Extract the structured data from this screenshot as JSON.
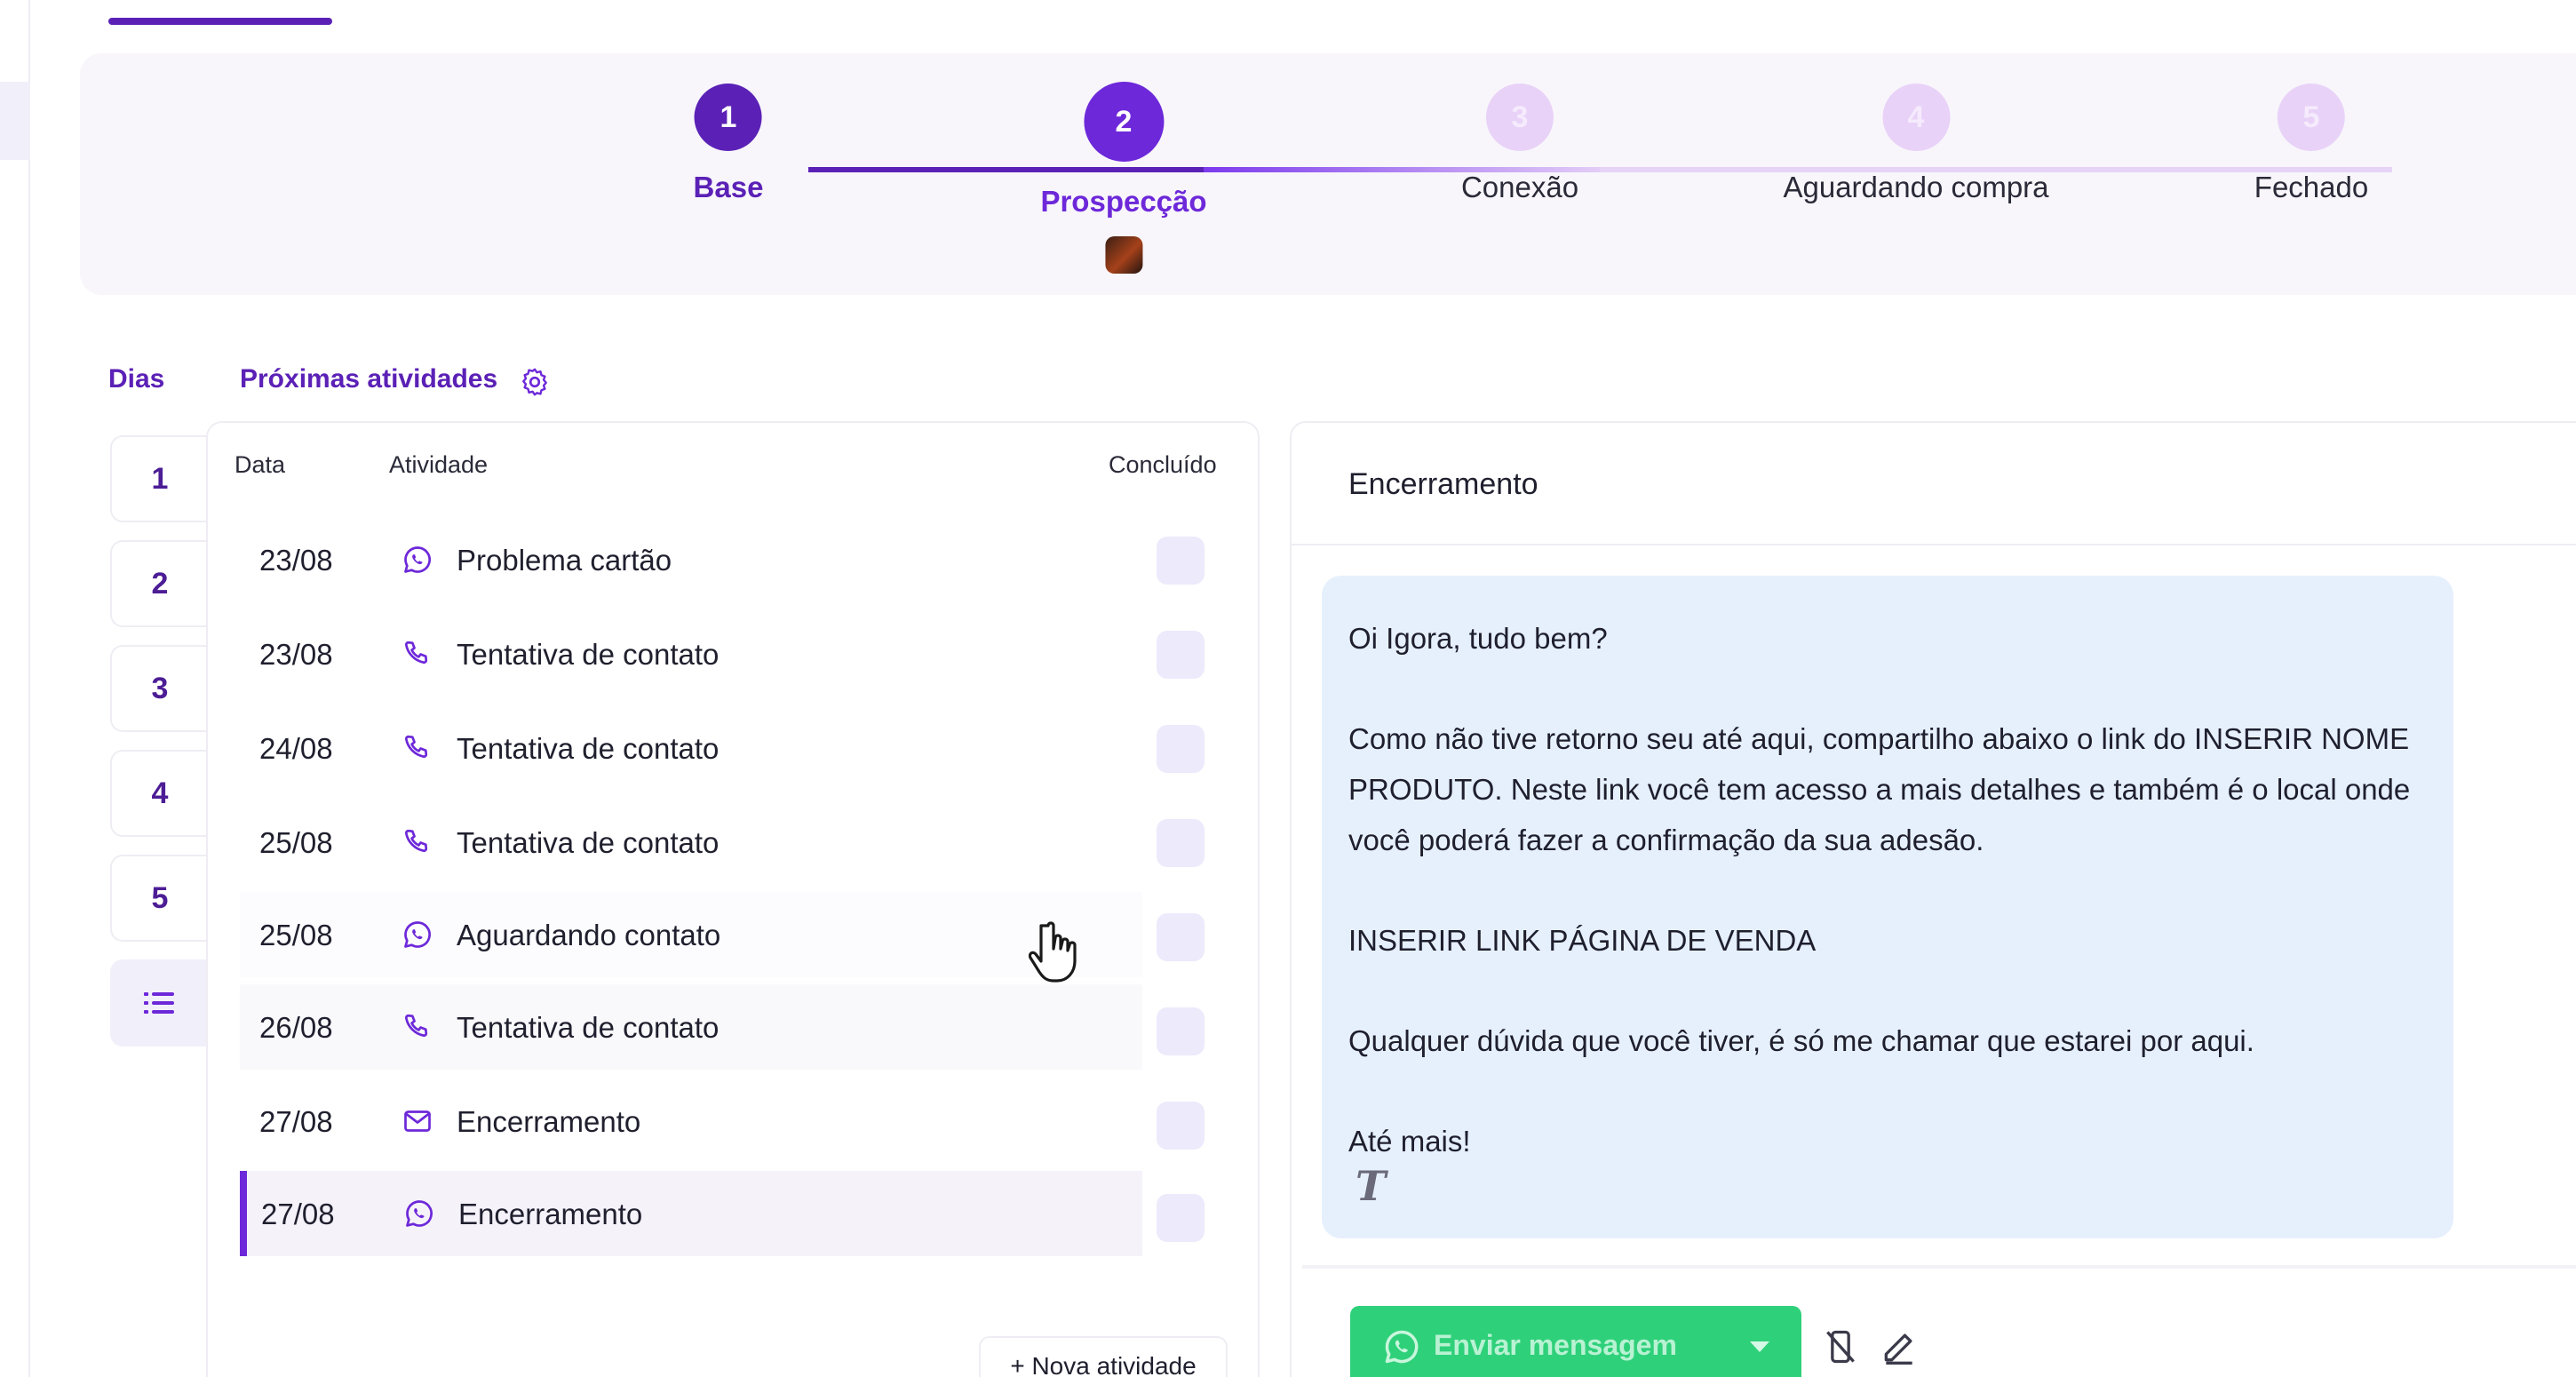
{
  "stepper": {
    "steps": [
      {
        "number": "1",
        "label": "Base",
        "state": "done"
      },
      {
        "number": "2",
        "label": "Prospecção",
        "state": "current"
      },
      {
        "number": "3",
        "label": "Conexão",
        "state": "todo"
      },
      {
        "number": "4",
        "label": "Aguardando compra",
        "state": "todo"
      },
      {
        "number": "5",
        "label": "Fechado",
        "state": "todo"
      }
    ]
  },
  "tabs": {
    "days_label": "Dias",
    "activities_label": "Próximas atividades"
  },
  "days": [
    "1",
    "2",
    "3",
    "4",
    "5"
  ],
  "table": {
    "headers": {
      "date": "Data",
      "activity": "Atividade",
      "done": "Concluído"
    },
    "rows": [
      {
        "date": "23/08",
        "type": "whatsapp-icon",
        "activity": "Problema cartão"
      },
      {
        "date": "23/08",
        "type": "phone-icon",
        "activity": "Tentativa de contato"
      },
      {
        "date": "24/08",
        "type": "phone-icon",
        "activity": "Tentativa de contato"
      },
      {
        "date": "25/08",
        "type": "phone-icon",
        "activity": "Tentativa de contato"
      },
      {
        "date": "25/08",
        "type": "whatsapp-icon",
        "activity": "Aguardando contato"
      },
      {
        "date": "26/08",
        "type": "phone-icon",
        "activity": "Tentativa de contato"
      },
      {
        "date": "27/08",
        "type": "mail-icon",
        "activity": "Encerramento"
      },
      {
        "date": "27/08",
        "type": "whatsapp-icon",
        "activity": "Encerramento"
      }
    ],
    "new_activity_label": "+ Nova atividade"
  },
  "message": {
    "title": "Encerramento",
    "paragraphs": [
      "Oi Igora, tudo bem?",
      "Como não tive retorno seu até aqui, compartilho abaixo o link do INSERIR NOME PRODUTO. Neste link você tem acesso a mais detalhes e também é o local onde você poderá fazer a confirmação da sua adesão.",
      "INSERIR LINK PÁGINA DE VENDA",
      "Qualquer dúvida que você tiver, é só me chamar que estarei por aqui.",
      "Até mais!"
    ],
    "send_label": "Enviar mensagem"
  },
  "colors": {
    "primary": "#5b21b6",
    "accent": "#6d28d9",
    "step_todo": "#e9d2f8",
    "bubble": "#e6f0fd",
    "send": "#2fd07a"
  }
}
